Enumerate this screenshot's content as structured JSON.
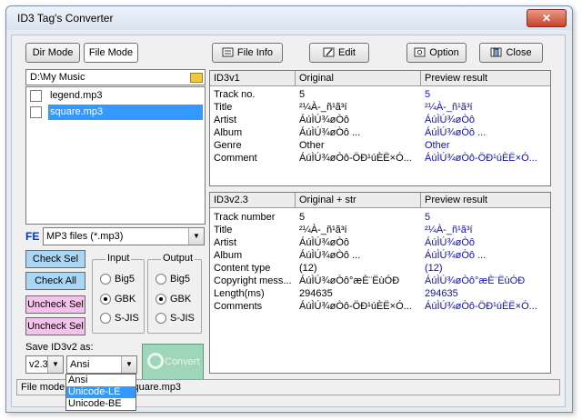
{
  "window": {
    "title": "ID3 Tag's Converter",
    "close_glyph": "✕"
  },
  "modes": {
    "dir": "Dir Mode",
    "file": "File Mode"
  },
  "toolbar": {
    "file_info": "File Info",
    "edit": "Edit",
    "option": "Option",
    "close": "Close"
  },
  "path": "D:\\My Music",
  "files": [
    {
      "name": "legend.mp3",
      "checked": false,
      "selected": false
    },
    {
      "name": "square.mp3",
      "checked": false,
      "selected": true
    }
  ],
  "filter": {
    "label": "FE",
    "value": "MP3 files (*.mp3)"
  },
  "buttons": {
    "check_sel": "Check Sel",
    "check_all": "Check All",
    "uncheck_sel": "Uncheck Sel",
    "uncheck_sel2": "Uncheck Sel"
  },
  "input_group": {
    "label": "Input",
    "options": [
      "Big5",
      "GBK",
      "S-JIS"
    ],
    "selected": "GBK"
  },
  "output_group": {
    "label": "Output",
    "options": [
      "Big5",
      "GBK",
      "S-JIS"
    ],
    "selected": "GBK"
  },
  "save": {
    "label": "Save ID3v2 as:",
    "version": "v2.3",
    "encoding": "Ansi"
  },
  "encoding_options": [
    "Ansi",
    "Unicode-LE",
    "Unicode-BE"
  ],
  "encoding_highlighted": "Unicode-LE",
  "convert_label": "Convert",
  "status": "File mode: D:\\My Music\\square.mp3",
  "id3v1": {
    "headers": [
      "ID3v1",
      "Original",
      "Preview result"
    ],
    "rows": [
      [
        "Track no.",
        "5",
        "5"
      ],
      [
        "Title",
        "²¼À-_ñ¹ã³í",
        "²¼À-_ñ¹ã³í"
      ],
      [
        "Artist",
        "ÁúÌÚ¾øÒô",
        "ÁúÌÚ¾øÒô"
      ],
      [
        "Album",
        "ÁúÌÚ¾øÒô                    ...",
        "ÁúÌÚ¾øÒô                    ..."
      ],
      [
        "Genre",
        "Other",
        "Other"
      ],
      [
        "Comment",
        "ÁúÌÚ¾øÒô-ÖÐ¹úÈË×Ó...",
        "ÁúÌÚ¾øÒô-ÖÐ¹úÈË×Ó..."
      ]
    ]
  },
  "id3v2": {
    "headers": [
      "ID3v2.3",
      "Original + str",
      "Preview result"
    ],
    "rows": [
      [
        "Track number",
        "5",
        "5"
      ],
      [
        "Title",
        "²¼À-_ñ¹ã³í",
        "²¼À-_ñ¹ã³í"
      ],
      [
        "Artist",
        "ÁúÌÚ¾øÒô",
        "ÁúÌÚ¾øÒô"
      ],
      [
        "Album",
        "ÁúÌÚ¾øÒô                    ...",
        "ÁúÌÚ¾øÒô                    ..."
      ],
      [
        "Content type",
        "(12)",
        "(12)"
      ],
      [
        "Copyright mess...",
        "ÁúÌÚ¾øÒô°æÈ¨ËùÓÐ",
        "ÁúÌÚ¾øÒô°æÈ¨ËùÓÐ"
      ],
      [
        "Length(ms)",
        "294635",
        "294635"
      ],
      [
        "Comments",
        "ÁúÌÚ¾øÒô-ÖÐ¹úÈË×Ó...",
        "ÁúÌÚ¾øÒô-ÖÐ¹úÈË×Ó..."
      ]
    ]
  }
}
